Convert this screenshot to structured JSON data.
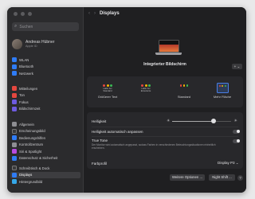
{
  "sidebar": {
    "search_placeholder": "Suchen",
    "user": {
      "name": "Andreas Hübner",
      "subtitle": "Apple ID"
    },
    "items": [
      {
        "label": "WLAN",
        "color": "#2f7cf6",
        "icon": "wifi-icon"
      },
      {
        "label": "Bluetooth",
        "color": "#2f7cf6",
        "icon": "bluetooth-icon"
      },
      {
        "label": "Netzwerk",
        "color": "#2f7cf6",
        "icon": "network-icon"
      },
      {
        "label": "Mitteilungen",
        "color": "#e5473f",
        "icon": "notifications-icon"
      },
      {
        "label": "Ton",
        "color": "#e5473f",
        "icon": "sound-icon"
      },
      {
        "label": "Fokus",
        "color": "#6e5be0",
        "icon": "focus-icon"
      },
      {
        "label": "Bildschirmzeit",
        "color": "#6e5be0",
        "icon": "screen-time-icon"
      },
      {
        "label": "Allgemein",
        "color": "#8e8e93",
        "icon": "general-icon"
      },
      {
        "label": "Erscheinungsbild",
        "color": "#3a3a3c",
        "icon": "appearance-icon"
      },
      {
        "label": "Bedienungshilfen",
        "color": "#2f7cf6",
        "icon": "accessibility-icon"
      },
      {
        "label": "Kontrollzentrum",
        "color": "#8e8e93",
        "icon": "control-center-icon"
      },
      {
        "label": "Siri & Spotlight",
        "color": "#b84be0",
        "icon": "siri-icon"
      },
      {
        "label": "Datenschutz & Sicherheit",
        "color": "#2f7cf6",
        "icon": "privacy-icon"
      },
      {
        "label": "Schreibtisch & Dock",
        "color": "#3a3a3c",
        "icon": "dock-icon"
      },
      {
        "label": "Displays",
        "color": "#2f7cf6",
        "icon": "displays-icon",
        "active": true
      },
      {
        "label": "Hintergrundbild",
        "color": "#35a7e8",
        "icon": "wallpaper-icon"
      }
    ]
  },
  "content": {
    "title": "Displays",
    "display_name": "Integrierter Bildschirm",
    "add_button": "+ ⌄",
    "resolution_options": [
      {
        "label": "Größerer Text",
        "preview": "Hallo bei Standard",
        "selected": false
      },
      {
        "label": "",
        "preview": "Hallo bei Erweiterte",
        "selected": false
      },
      {
        "label": "Standard",
        "preview": "",
        "selected": false
      },
      {
        "label": "Mehr Fläche",
        "preview": "",
        "selected": true
      }
    ],
    "brightness": {
      "label": "Helligkeit",
      "value": 0.7
    },
    "auto_brightness": {
      "label": "Helligkeit automatisch anpassen",
      "on": true
    },
    "true_tone": {
      "label": "True Tone",
      "description": "Der Monitor wird automatisch angepasst, sodass Farben in verschiedenen Beleuchtungssituationen einheitlich erscheinen.",
      "on": true
    },
    "color_profile": {
      "label": "Farbprofil",
      "value": "Display P3 ⌄"
    },
    "buttons": {
      "advanced": "Weitere Optionen ...",
      "night_shift": "Night Shift ...",
      "help": "?"
    }
  }
}
